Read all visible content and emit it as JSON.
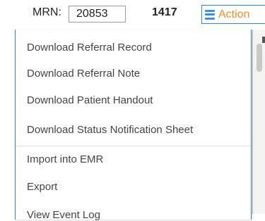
{
  "header": {
    "mrn_label": "MRN:",
    "mrn_value": "20853",
    "visit_number": "1417",
    "action_button": {
      "label": "Action",
      "icon": "hamburger-icon",
      "label_color": "#f08a2c",
      "border_color": "#2f87d8"
    }
  },
  "menu": {
    "items": [
      {
        "label": "Download Referral Record"
      },
      {
        "label": "Download Referral Note"
      },
      {
        "label": "Download Patient Handout"
      },
      {
        "label": "Download Status Notification Sheet"
      },
      {
        "label": "Import into EMR"
      },
      {
        "label": "Export"
      },
      {
        "label": "View Event Log"
      }
    ],
    "border_color": "#3b7fc4"
  }
}
